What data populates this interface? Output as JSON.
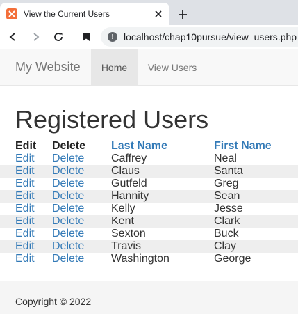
{
  "browser": {
    "tab_title": "View the Current Users",
    "url": "localhost/chap10pursue/view_users.php"
  },
  "navbar": {
    "brand": "My Website",
    "links": [
      {
        "label": "Home",
        "active": true
      },
      {
        "label": "View Users",
        "active": false
      }
    ]
  },
  "page": {
    "title": "Registered Users"
  },
  "table": {
    "headers": {
      "edit": "Edit",
      "delete": "Delete",
      "last_name": "Last Name",
      "first_name": "First Name"
    },
    "rows": [
      {
        "edit": "Edit",
        "delete": "Delete",
        "last_name": "Caffrey",
        "first_name": "Neal"
      },
      {
        "edit": "Edit",
        "delete": "Delete",
        "last_name": "Claus",
        "first_name": "Santa"
      },
      {
        "edit": "Edit",
        "delete": "Delete",
        "last_name": "Gutfeld",
        "first_name": "Greg"
      },
      {
        "edit": "Edit",
        "delete": "Delete",
        "last_name": "Hannity",
        "first_name": "Sean"
      },
      {
        "edit": "Edit",
        "delete": "Delete",
        "last_name": "Kelly",
        "first_name": "Jesse"
      },
      {
        "edit": "Edit",
        "delete": "Delete",
        "last_name": "Kent",
        "first_name": "Clark"
      },
      {
        "edit": "Edit",
        "delete": "Delete",
        "last_name": "Sexton",
        "first_name": "Buck"
      },
      {
        "edit": "Edit",
        "delete": "Delete",
        "last_name": "Travis",
        "first_name": "Clay"
      },
      {
        "edit": "Edit",
        "delete": "Delete",
        "last_name": "Washington",
        "first_name": "George"
      }
    ]
  },
  "footer": {
    "copyright": "Copyright © 2022"
  },
  "icons": {
    "favicon": "xampp-favicon",
    "tab_close": "close-icon",
    "new_tab": "plus-icon",
    "back": "back-arrow-icon",
    "forward": "forward-arrow-icon",
    "reload": "reload-icon",
    "bookmark": "bookmark-icon",
    "site_info": "info-icon"
  },
  "colors": {
    "link": "#337ab7",
    "navbar_bg": "#f8f8f8",
    "active_nav_bg": "#e7e7e7",
    "stripe": "#eeeeee",
    "footer_bg": "#f5f5f5"
  }
}
